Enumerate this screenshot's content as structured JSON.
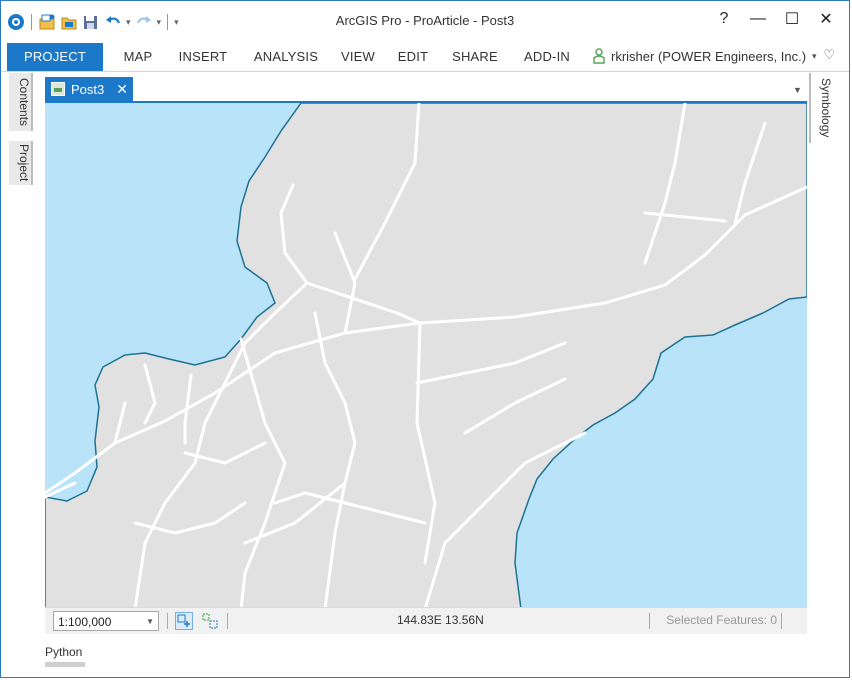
{
  "window": {
    "title": "ArcGIS Pro - ProArticle - Post3",
    "controls": {
      "help": "?",
      "minimize": "—",
      "maximize": "☐",
      "close": "✕"
    }
  },
  "quick_access": {
    "icons": [
      "arcgis-logo-icon",
      "new-project-icon",
      "open-project-icon",
      "save-project-icon",
      "undo-icon",
      "redo-icon",
      "customize-icon"
    ]
  },
  "ribbon": {
    "tabs": [
      "PROJECT",
      "MAP",
      "INSERT",
      "ANALYSIS",
      "VIEW",
      "EDIT",
      "SHARE",
      "ADD-IN"
    ],
    "active_tab": "PROJECT",
    "user": "rkrisher (POWER Engineers, Inc.)"
  },
  "left_panes": [
    "Contents",
    "Project"
  ],
  "right_panes": [
    "Symbology"
  ],
  "view": {
    "tab_label": "Post3",
    "close_symbol": "✕"
  },
  "statusbar": {
    "scale": "1:100,000",
    "coordinates": "144.83E 13.56N",
    "selected_features": "Selected Features: 0"
  },
  "bottom_pane": {
    "label": "Python"
  },
  "colors": {
    "accent": "#1c79c9",
    "water": "#b8e3f9",
    "land": "#e1e1e1",
    "coastline": "#1d7294",
    "roads": "#ffffff"
  }
}
